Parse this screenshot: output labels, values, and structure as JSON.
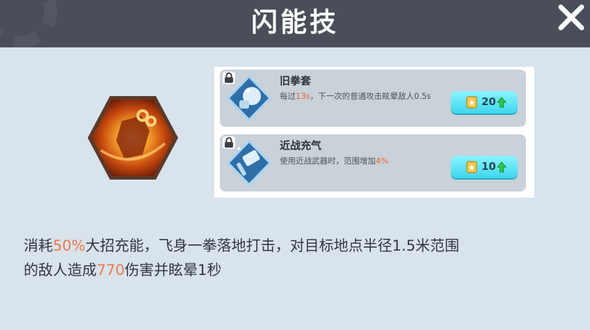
{
  "header": {
    "title": "闪能技"
  },
  "skill": {
    "desc_part1": "消耗",
    "desc_hl1": "50%",
    "desc_part2": "大招充能，飞身一拳落地打击，对目标地点半径1.5米范围",
    "desc_part3": "的敌人造成",
    "desc_hl2": "770",
    "desc_part4": "伤害并眩晕1秒"
  },
  "upgrades": [
    {
      "name": "旧拳套",
      "desc_a": "每过",
      "desc_hl": "13s",
      "desc_b": "，下一次的普通攻击眩晕敌人0.5s",
      "cost": "20",
      "icon": "boxing-glove-icon"
    },
    {
      "name": "近战充气",
      "desc_a": "使用近战武器时，范围增加",
      "desc_hl": "4%",
      "desc_b": "",
      "cost": "10",
      "icon": "hammer-icon"
    }
  ],
  "colors": {
    "header": "#4a4e58",
    "panel": "#d9e3ec",
    "highlight": "#ef7a4c",
    "cost_button": "#5fe3f5"
  }
}
